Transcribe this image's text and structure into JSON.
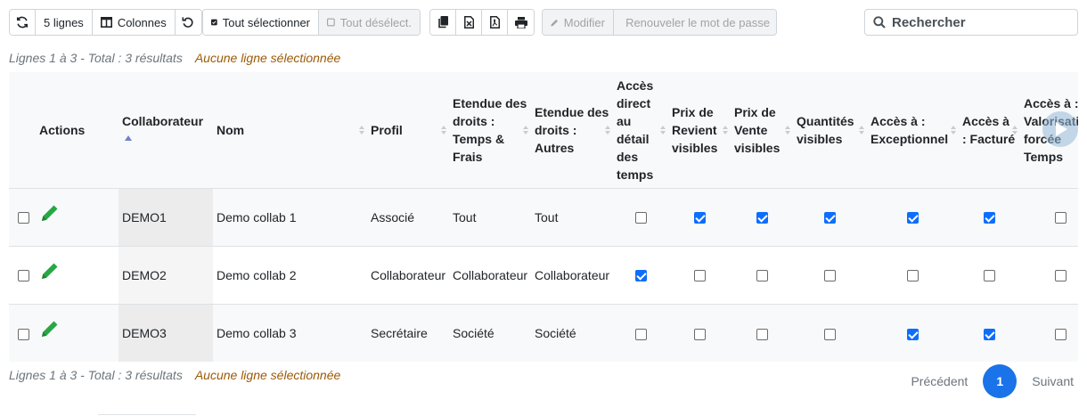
{
  "toolbar": {
    "refresh_icon": "refresh-icon",
    "rows_label": "5 lignes",
    "columns_label": "Colonnes",
    "reset_icon": "undo-icon",
    "select_all_label": "Tout sélectionner",
    "deselect_all_label": "Tout désélect.",
    "export_icons": [
      "copy-icon",
      "excel-icon",
      "pdf-icon",
      "print-icon"
    ],
    "modify_label": "Modifier",
    "renew_password_label": "Renouveler le mot de passe",
    "search_placeholder": "Rechercher"
  },
  "info_top": {
    "lines": "Lignes 1 à 3 - Total : 3 résultats",
    "selection": "Aucune ligne sélectionnée"
  },
  "info_bottom": {
    "lines": "Lignes 1 à 3 - Total : 3 résultats",
    "selection": "Aucune ligne sélectionnée"
  },
  "columns": [
    "Actions",
    "Collaborateur",
    "Nom",
    "Profil",
    "Etendue des droits : Temps & Frais",
    "Etendue des droits : Autres",
    "Accès direct au détail des temps",
    "Prix de Revient visibles",
    "Prix de Vente visibles",
    "Quantités visibles",
    "Accès à : Exceptionnel",
    "Accès à : Facturé",
    "Accès à : Valorisation forcée Temps"
  ],
  "rows": [
    {
      "collaborateur": "DEMO1",
      "nom": "Demo collab 1",
      "profil": "Associé",
      "temps_frais": "Tout",
      "autres": "Tout",
      "checks": [
        false,
        true,
        true,
        true,
        true,
        true,
        false
      ]
    },
    {
      "collaborateur": "DEMO2",
      "nom": "Demo collab 2",
      "profil": "Collaborateur",
      "temps_frais": "Collaborateur",
      "autres": "Collaborateur",
      "checks": [
        true,
        false,
        false,
        false,
        false,
        false,
        false
      ]
    },
    {
      "collaborateur": "DEMO3",
      "nom": "Demo collab 3",
      "profil": "Secrétaire",
      "temps_frais": "Société",
      "autres": "Société",
      "checks": [
        false,
        false,
        false,
        false,
        true,
        true,
        false
      ]
    }
  ],
  "pagination": {
    "prev": "Précédent",
    "current": "1",
    "next": "Suivant"
  },
  "colors": {
    "accent": "#1a73e8",
    "checked": "#0d6efd",
    "edit": "#28a745",
    "selection_text": "#9c5a07"
  }
}
